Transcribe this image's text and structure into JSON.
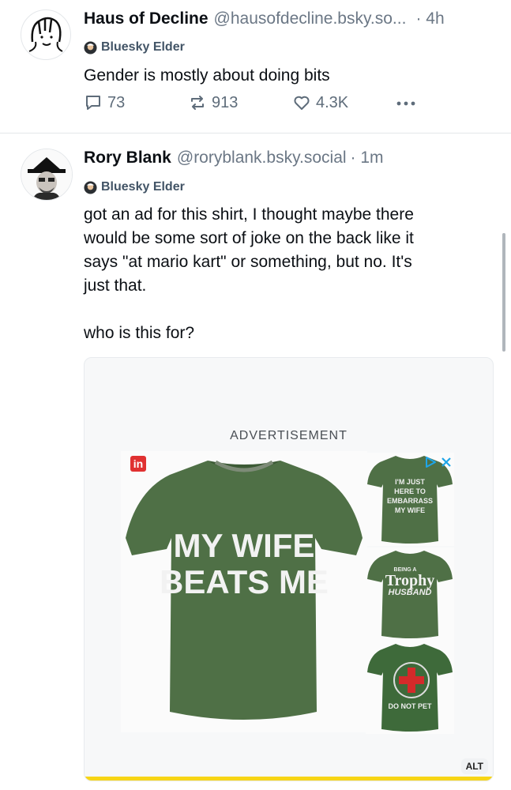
{
  "post1": {
    "name": "Haus of Decline",
    "handle": "@hausofdecline.bsky.so...",
    "time": "· 4h",
    "badge": "Bluesky Elder",
    "text": "Gender is mostly about doing bits",
    "replies": "73",
    "reposts": "913",
    "likes": "4.3K"
  },
  "post2": {
    "name": "Rory Blank",
    "handle": "@roryblank.bsky.social",
    "time": "· 1m",
    "badge": "Bluesky Elder",
    "text_lines": [
      "got an ad for this shirt, I thought maybe there",
      "would be some sort of joke on the back like it",
      "says \"at mario kart\" or something, but no. It's",
      "just that.",
      "who is this for?"
    ],
    "image": {
      "ad_label": "ADVERTISEMENT",
      "alt_label": "ALT",
      "main_shirt_line1": "MY WIFE",
      "main_shirt_line2": "BEATS ME",
      "thumb1": [
        "I'M JUST",
        "HERE TO",
        "EMBARRASS",
        "MY WIFE"
      ],
      "thumb2_small": "BEING A",
      "thumb2_big": "Trophy",
      "thumb2_under": "HUSBAND",
      "thumb3_bottom": "DO NOT PET"
    }
  },
  "colors": {
    "shirt": "#4f7046",
    "shirt_dark": "#3c5a35",
    "accent_blue": "#1185fe",
    "ad_red": "#e03131"
  }
}
